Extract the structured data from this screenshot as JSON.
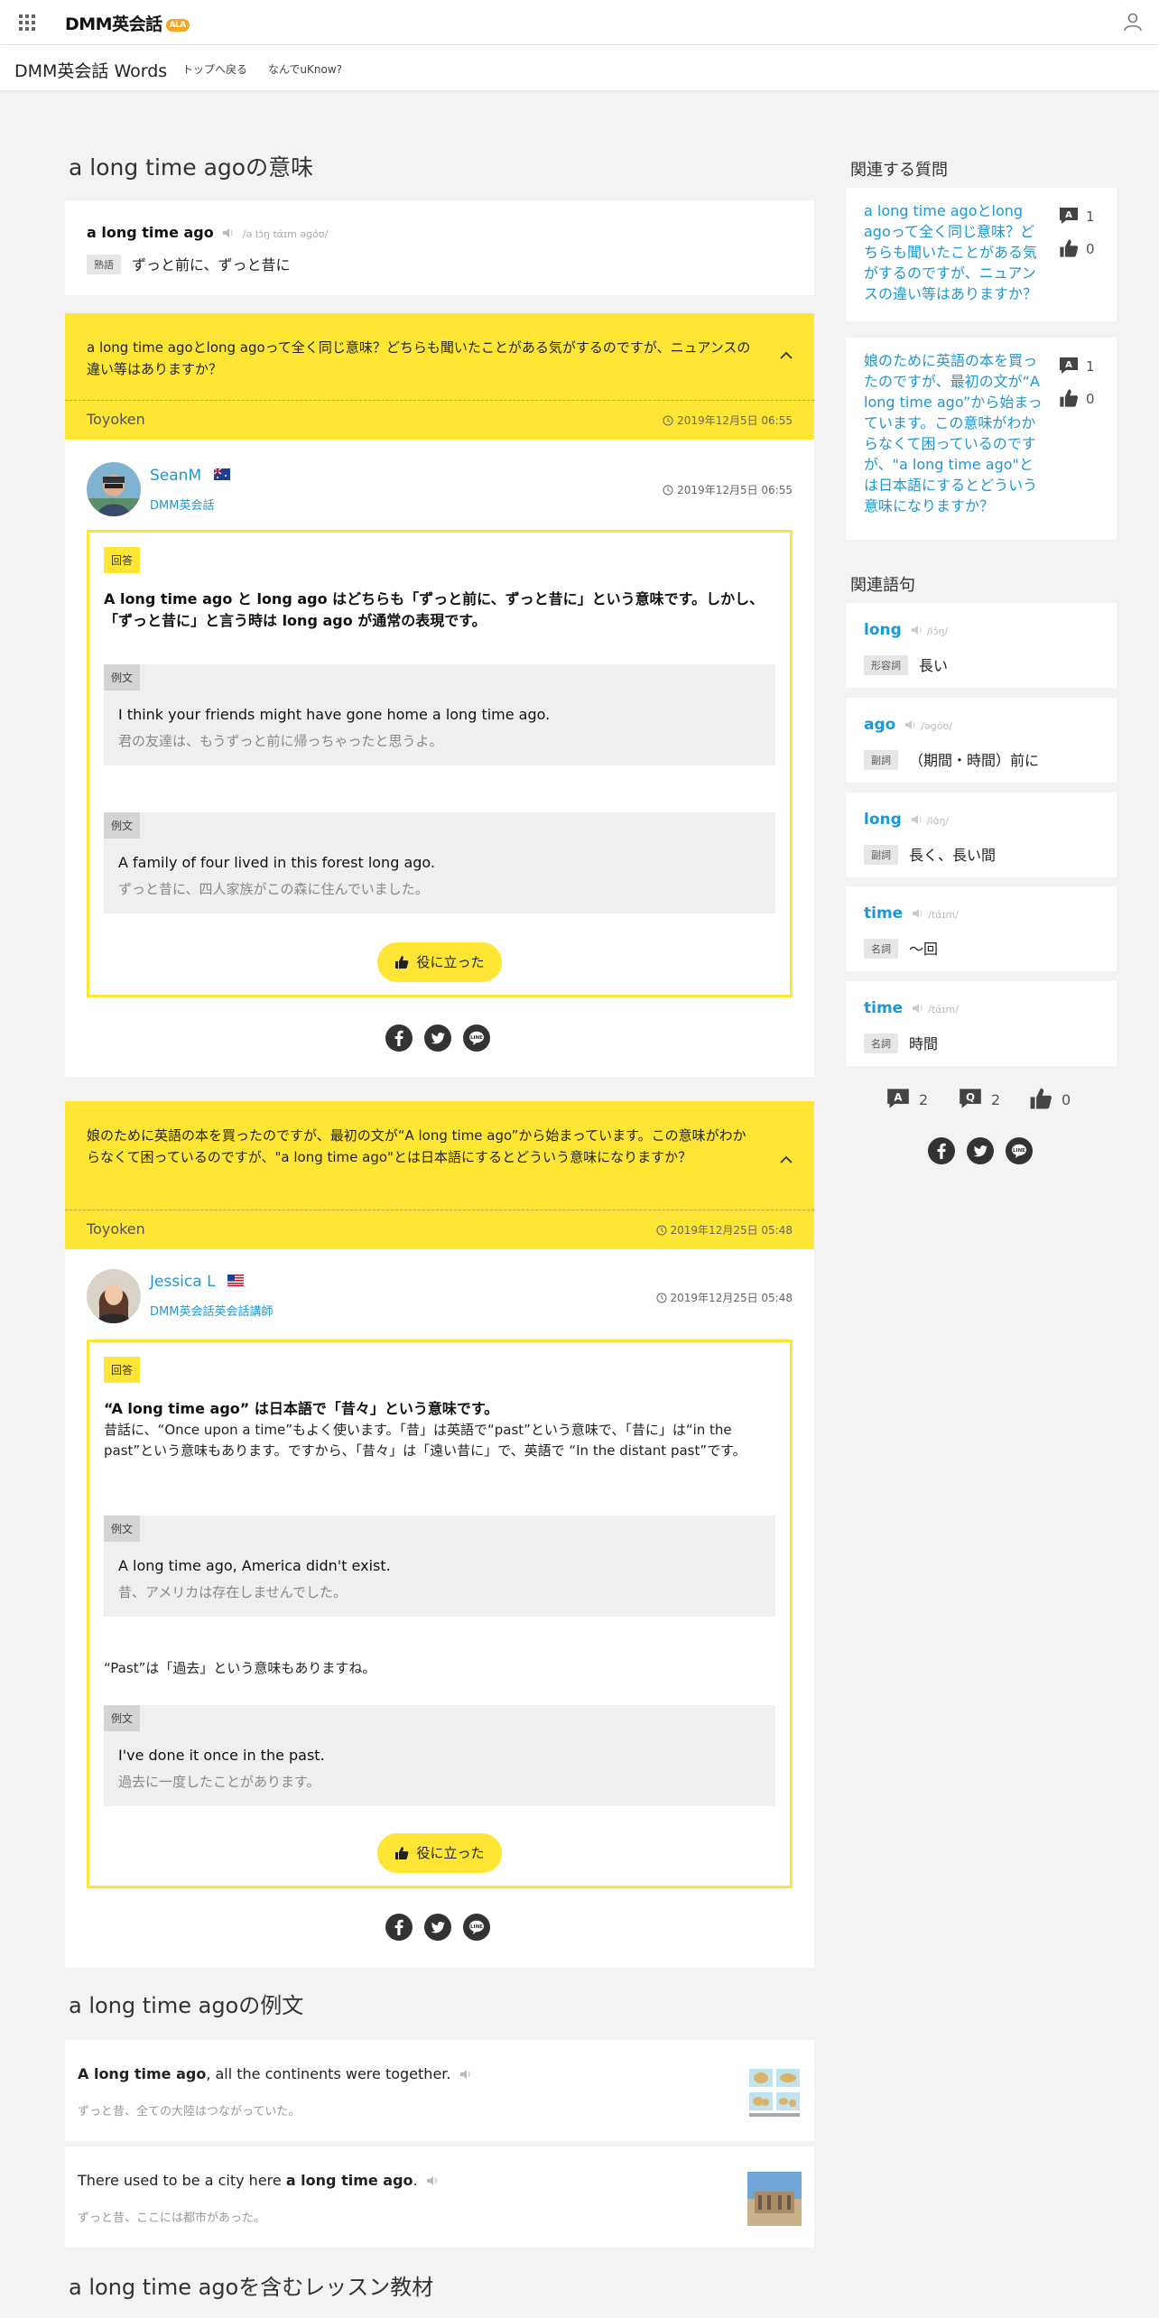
{
  "header": {
    "logo": "DMM英会話",
    "logo_badge": "ALA",
    "brand": "DMM英会話 Words",
    "links": [
      "トップへ戻る",
      "なんでuKnow?"
    ]
  },
  "title": "a long time agoの意味",
  "entry": {
    "word": "a long time ago",
    "phonetic": "/ə lɔ́ŋ tάɪm əɡóʊ/",
    "pos": "熟語",
    "meaning": "ずっと前に、ずっと昔に"
  },
  "questions": [
    {
      "text": "a long time agoとlong agoって全く同じ意味？どちらも聞いたことがある気がするのですが、ニュアンスの違い等はありますか？",
      "asker": "Toyoken",
      "asked": "2019年12月5日 06:55",
      "answer": {
        "name": "SeanM",
        "org": "DMM英会話",
        "date": "2019年12月5日 06:55",
        "tag": "回答",
        "strong": "A long time ago と long ago はどちらも「ずっと前に、ずっと昔に」という意味です。しかし、「ずっと昔に」と言う時は long ago が通常の表現です。",
        "examples": [
          {
            "tag": "例文",
            "en": "I think your friends might have gone home a long time ago.",
            "ja": "君の友達は、もうずっと前に帰っちゃったと思うよ。"
          },
          {
            "tag": "例文",
            "en": "A family of four lived in this forest long ago.",
            "ja": "ずっと昔に、四人家族がこの森に住んでいました。"
          }
        ],
        "helpful": "役に立った"
      }
    },
    {
      "text": "娘のために英語の本を買ったのですが、最初の文が“A long time ago”から始まっています。この意味がわからなくて困っているのですが、\"a long time ago\"とは日本語にするとどういう意味になりますか？",
      "asker": "Toyoken",
      "asked": "2019年12月25日 05:48",
      "answer": {
        "name": "Jessica L",
        "org": "DMM英会話英会話講師",
        "date": "2019年12月25日 05:48",
        "tag": "回答",
        "strong": "“A long time ago” は日本語で「昔々」という意味です。",
        "body": "昔話に、“Once upon a time”もよく使います。「昔」は英語で“past”という意味で、「昔に」は“in the past”という意味もあります。ですから、「昔々」は「遠い昔に」で、英語で “In the distant past”です。",
        "examples": [
          {
            "tag": "例文",
            "en": "A long time ago, America didn't exist.",
            "ja": "昔、アメリカは存在しませんでした。"
          },
          {
            "tag": "例文",
            "en": "I've done it once in the past.",
            "ja": "過去に一度したことがあります。"
          }
        ],
        "mid": "“Past”は「過去」という意味もありますね。",
        "helpful": "役に立った"
      }
    }
  ],
  "examples_section": {
    "title": "a long time agoの例文",
    "items": [
      {
        "en_bold": "A long time ago",
        "en_rest": ", all the continents were together.",
        "ja": "ずっと昔、全ての大陸はつながっていた。"
      },
      {
        "en_pre": "There used to be a city here ",
        "en_bold": "a long time ago",
        "en_rest": ".",
        "ja": "ずっと昔、ここには都市があった。"
      }
    ]
  },
  "lesson_title": "a long time agoを含むレッスン教材",
  "sidebar": {
    "related_q_title": "関連する質問",
    "related_questions": [
      {
        "text": "a long time agoとlong agoって全く同じ意味？どちらも聞いたことがある気がするのですが、ニュアンスの違い等はありますか？",
        "answers": "1",
        "likes": "0"
      },
      {
        "text": "娘のために英語の本を買ったのですが、最初の文が“A long time ago”から始まっています。この意味がわからなくて困っているのですが、\"a long time ago\"とは日本語にするとどういう意味になりますか？",
        "answers": "1",
        "likes": "0"
      }
    ],
    "related_w_title": "関連語句",
    "related_words": [
      {
        "word": "long",
        "phonetic": "/lɔ́ŋ/",
        "pos": "形容詞",
        "meaning": "長い"
      },
      {
        "word": "ago",
        "phonetic": "/əɡóʊ/",
        "pos": "副詞",
        "meaning": "（期間・時間）前に"
      },
      {
        "word": "long",
        "phonetic": "/lɑ́ŋ/",
        "pos": "副詞",
        "meaning": "長く、長い間"
      },
      {
        "word": "time",
        "phonetic": "/tάɪm/",
        "pos": "名詞",
        "meaning": "～回"
      },
      {
        "word": "time",
        "phonetic": "/tάɪm/",
        "pos": "名詞",
        "meaning": "時間"
      }
    ],
    "stats": {
      "answers": "2",
      "questions": "2",
      "likes": "0"
    }
  }
}
